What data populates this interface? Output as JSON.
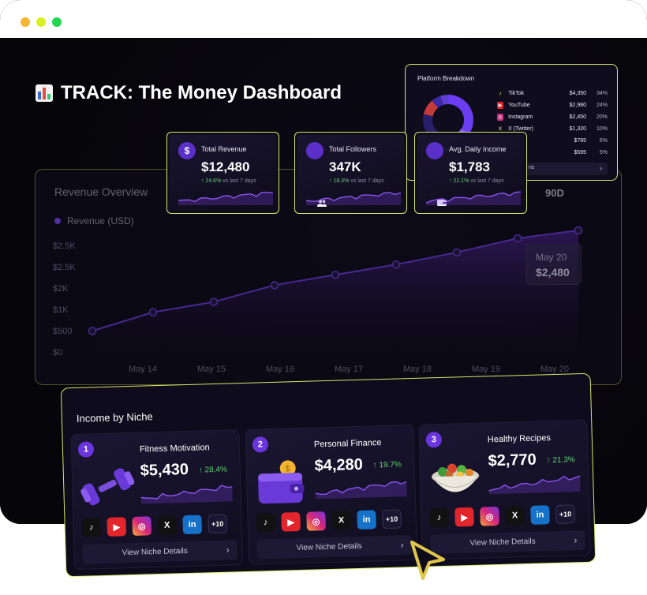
{
  "window": {
    "dot_colors": [
      "#f5b731",
      "#d9f021",
      "#22d64d"
    ]
  },
  "app": {
    "title": "TRACK: The Money Dashboard",
    "title_icon": "bar-chart-emoji-icon"
  },
  "revenue_overview": {
    "title": "Revenue Overview",
    "legend": "Revenue (USD)",
    "range_button": "90D",
    "tooltip_date": "May 20",
    "tooltip_value": "$2,480",
    "y_ticks": [
      "$2.5K",
      "$2.5K",
      "$2K",
      "$1K",
      "$500",
      "$0"
    ],
    "x_ticks": [
      "May 14",
      "May 15",
      "May 16",
      "May 17",
      "May 18",
      "May 19",
      "May 20"
    ]
  },
  "chart_data": {
    "type": "area",
    "title": "Revenue Overview",
    "series": [
      {
        "name": "Revenue (USD)",
        "values": [
          500,
          900,
          1120,
          1480,
          1700,
          1920,
          2180,
          2480,
          2650
        ]
      }
    ],
    "ylim": [
      0,
      2800
    ],
    "grid": false,
    "legend": "top-left"
  },
  "stats": [
    {
      "label": "Total Revenue",
      "value": "$12,480",
      "change": "24.6%",
      "period": "vs last 7 days",
      "icon": "dollar-icon"
    },
    {
      "label": "Total Followers",
      "value": "347K",
      "change": "18.3%",
      "period": "vs last 7 days",
      "icon": "users-icon"
    },
    {
      "label": "Avg. Daily Income",
      "value": "$1,783",
      "change": "22.1%",
      "period": "vs last 7 days",
      "icon": "wallet-icon"
    }
  ],
  "platform_breakdown": {
    "title": "Platform Breakdown",
    "rows": [
      {
        "name": "TikTok",
        "value": "$4,350",
        "pct": "34%",
        "color": "#111111",
        "glyph": "♪"
      },
      {
        "name": "YouTube",
        "value": "$2,980",
        "pct": "24%",
        "color": "#e3252c",
        "glyph": "▶"
      },
      {
        "name": "Instagram",
        "value": "$2,450",
        "pct": "20%",
        "color": "#c6317e",
        "glyph": "◎"
      },
      {
        "name": "X (Twitter)",
        "value": "$1,320",
        "pct": "10%",
        "color": "#111111",
        "glyph": "X"
      },
      {
        "name": "n",
        "value": "$785",
        "pct": "6%",
        "color": "#0f0c1d",
        "glyph": ""
      },
      {
        "name": "",
        "value": "$595",
        "pct": "5%",
        "color": "#0f0c1d",
        "glyph": ""
      }
    ],
    "footer": "ns",
    "donut_colors": [
      "#6a3df0",
      "#8e5cf7",
      "#2a1f6a",
      "#c43b3b",
      "#3b2aa8",
      "#5d3fd1"
    ],
    "donut_values": [
      34,
      24,
      20,
      10,
      6,
      5
    ]
  },
  "income_by_niche": {
    "title": "Income by Niche",
    "cards": [
      {
        "rank": "1",
        "name": "Fitness Motivation",
        "value": "$5,430",
        "growth": "28.4%",
        "more": "+10",
        "cta": "View Niche Details"
      },
      {
        "rank": "2",
        "name": "Personal Finance",
        "value": "$4,280",
        "growth": "19.7%",
        "more": "+10",
        "cta": "View Niche Details"
      },
      {
        "rank": "3",
        "name": "Healthy Recipes",
        "value": "$2,770",
        "growth": "21.3%",
        "more": "+10",
        "cta": "View Niche Details"
      }
    ]
  }
}
